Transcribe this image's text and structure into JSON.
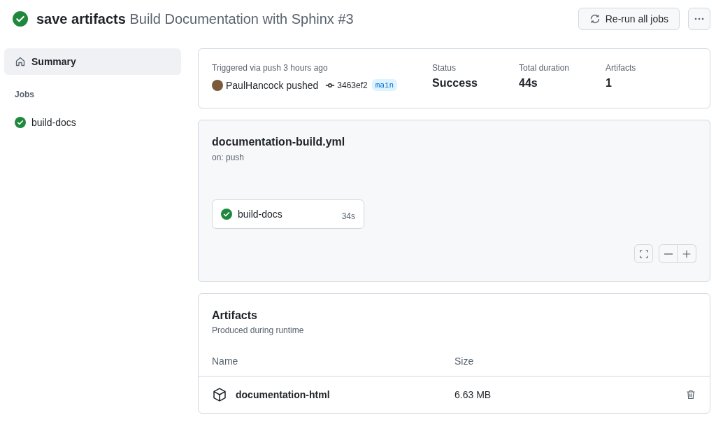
{
  "header": {
    "kind": "success",
    "title_bold": "save artifacts",
    "title_rest": "Build Documentation with Sphinx #3",
    "rerun_label": "Re-run all jobs"
  },
  "sidebar": {
    "items": [
      {
        "label": "Summary",
        "selected": true
      }
    ],
    "jobs_heading": "Jobs",
    "jobs": [
      {
        "label": "build-docs",
        "kind": "success"
      }
    ]
  },
  "summary": {
    "trigger": "Triggered via push 3 hours ago",
    "actor_line": "PaulHancock pushed",
    "commit": "3463ef2",
    "branch": "main",
    "stats": [
      {
        "label": "Status",
        "value": "Success"
      },
      {
        "label": "Total duration",
        "value": "44s"
      },
      {
        "label": "Artifacts",
        "value": "1"
      }
    ]
  },
  "workflow": {
    "file": "documentation-build.yml",
    "event": "on: push",
    "jobs": [
      {
        "name": "build-docs",
        "kind": "success",
        "duration": "34s"
      }
    ]
  },
  "artifacts": {
    "title": "Artifacts",
    "subtitle": "Produced during runtime",
    "columns": [
      "Name",
      "Size"
    ],
    "rows": [
      {
        "name": "documentation-html",
        "size": "6.63 MB"
      }
    ]
  }
}
